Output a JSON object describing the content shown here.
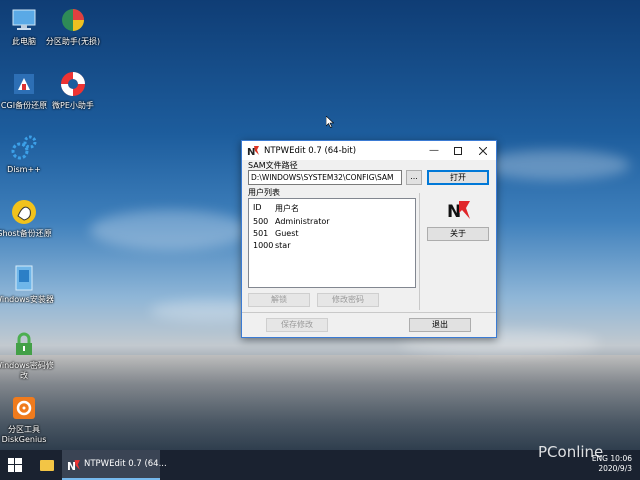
{
  "desktop": {
    "icons": [
      {
        "label": "此电脑",
        "icon": "computer-icon"
      },
      {
        "label": "分区助手(无损)",
        "icon": "partition-assistant-icon"
      },
      {
        "label": "CGI备份还原",
        "icon": "cgi-backup-icon"
      },
      {
        "label": "微PE小助手",
        "icon": "lifebuoy-icon"
      },
      {
        "label": "Dism++",
        "icon": "gears-icon"
      },
      {
        "label": "Ghost备份还原",
        "icon": "ghost-icon"
      },
      {
        "label": "Windows安装器",
        "icon": "windows-installer-icon"
      },
      {
        "label": "Windows密码修改",
        "icon": "password-lock-icon"
      },
      {
        "label": "分区工具DiskGenius",
        "icon": "diskgenius-icon"
      }
    ]
  },
  "dialog": {
    "title": "NTPWEdit 0.7 (64-bit)",
    "sam_label": "SAM文件路径",
    "sam_path": "D:\\WINDOWS\\SYSTEM32\\CONFIG\\SAM",
    "browse_label": "...",
    "open_label": "打开",
    "users_label": "用户列表",
    "columns": {
      "id": "ID",
      "name": "用户名"
    },
    "users": [
      {
        "id": "500",
        "name": "Administrator"
      },
      {
        "id": "501",
        "name": "Guest"
      },
      {
        "id": "1000",
        "name": "star"
      }
    ],
    "about_label": "关于",
    "unlock_label": "解锁",
    "change_password_label": "修改密码",
    "save_label": "保存修改",
    "exit_label": "退出"
  },
  "taskbar": {
    "task_label": "NTPWEdit 0.7 (64...",
    "tray_lang": "ENG",
    "tray_time": "10:06",
    "tray_date": "2020/9/3"
  },
  "watermark": "PConline",
  "colors": {
    "accent": "#0078d7",
    "taskbar": "#1a2230"
  }
}
